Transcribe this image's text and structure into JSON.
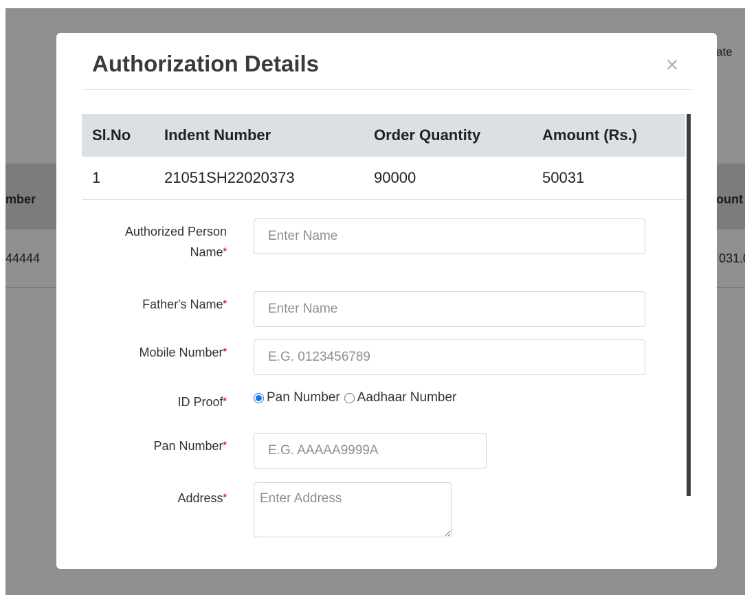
{
  "background": {
    "header_left_fragment": "mber",
    "header_right_fragment": "ount",
    "row_left_fragment": "44444",
    "row_right_fragment": "031.0",
    "top_right_fragment": "ate"
  },
  "modal": {
    "title": "Authorization Details",
    "close_symbol": "×",
    "table": {
      "headers": [
        "Sl.No",
        "Indent Number",
        "Order Quantity",
        "Amount (Rs.)"
      ],
      "rows": [
        [
          "1",
          "21051SH22020373",
          "90000",
          "50031"
        ]
      ]
    },
    "form": {
      "authorized_person": {
        "label_line1": "Authorized Person",
        "label_line2": "Name",
        "placeholder": "Enter Name",
        "value": ""
      },
      "fathers_name": {
        "label": "Father's Name",
        "placeholder": "Enter Name",
        "value": ""
      },
      "mobile_number": {
        "label": "Mobile Number",
        "placeholder": "E.G. 0123456789",
        "value": ""
      },
      "id_proof": {
        "label": "ID Proof",
        "options": [
          "Pan Number",
          "Aadhaar Number"
        ],
        "selected": "Pan Number"
      },
      "pan_number": {
        "label": "Pan Number",
        "placeholder": "E.G. AAAAA9999A",
        "value": ""
      },
      "address": {
        "label": "Address",
        "placeholder": "Enter Address",
        "value": ""
      },
      "required_marker": "*"
    }
  },
  "colors": {
    "overlay": "#8f8f8f",
    "table_header_bg": "#dcdfe3",
    "required": "#d9262e",
    "radio_accent": "#1a73e8"
  }
}
